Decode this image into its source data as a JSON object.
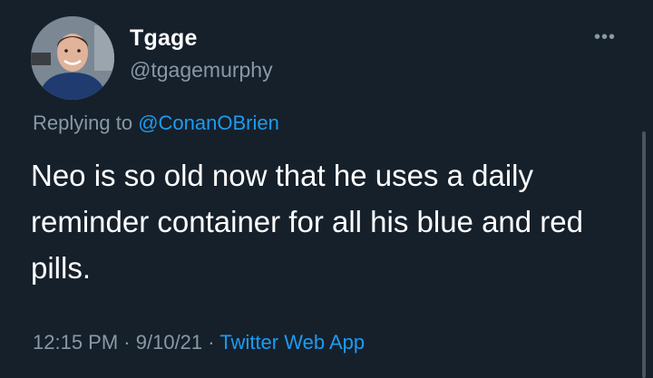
{
  "tweet": {
    "display_name": "Tgage",
    "handle": "@tgagemurphy",
    "more_icon": "more-horizontal-icon",
    "replying_prefix": "Replying to",
    "replying_handle": "@ConanOBrien",
    "text": "Neo is so old now that he uses a daily reminder container for all his blue and red pills.",
    "time": "12:15 PM",
    "separator": "·",
    "date": "9/10/21",
    "source": "Twitter Web App"
  },
  "colors": {
    "background": "#15202b",
    "secondary_text": "#8899a6",
    "link": "#1d9bf0"
  }
}
